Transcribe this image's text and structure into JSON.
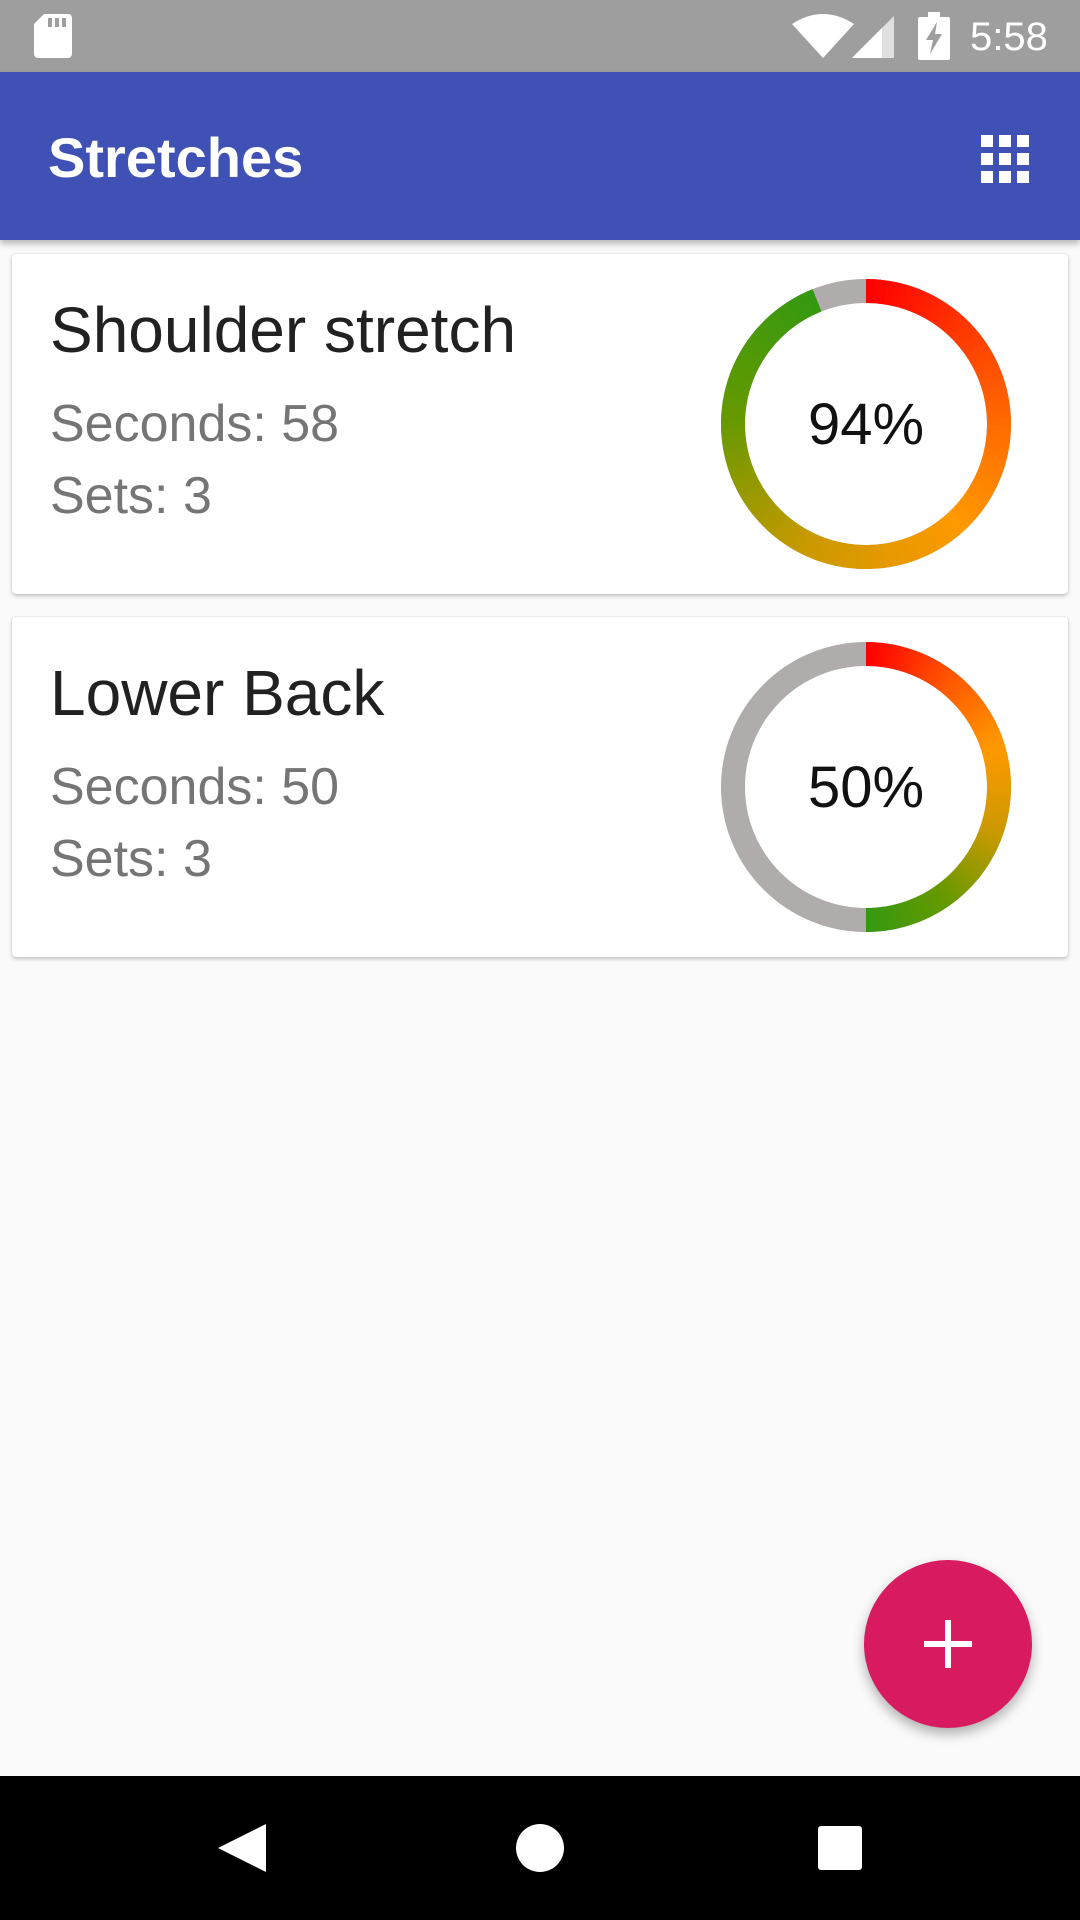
{
  "status_bar": {
    "time": "5:58",
    "icons": [
      "sd-card-icon",
      "wifi-icon",
      "cell-signal-icon",
      "battery-charging-icon"
    ]
  },
  "app_bar": {
    "title": "Stretches",
    "action_icon": "grid-icon"
  },
  "stretches": [
    {
      "name": "Shoulder stretch",
      "seconds_text": "Seconds: 58",
      "sets_text": "Sets: 3",
      "progress": 0.94,
      "progress_label": "94%"
    },
    {
      "name": "Lower Back",
      "seconds_text": "Seconds: 50",
      "sets_text": "Sets: 3",
      "progress": 0.5,
      "progress_label": "50%"
    }
  ],
  "fab": {
    "icon": "plus-icon"
  },
  "nav_bar": {
    "icons": [
      "back-icon",
      "home-icon",
      "recents-icon"
    ]
  },
  "colors": {
    "app_bar": "#3f51b5",
    "status_bar": "#9e9e9e",
    "fab": "#d81b60",
    "ring_track": "#b0acac",
    "ring_gradient": [
      "#ff0000",
      "#ff5500",
      "#ff9900",
      "#cc9900",
      "#669900",
      "#339911"
    ]
  }
}
